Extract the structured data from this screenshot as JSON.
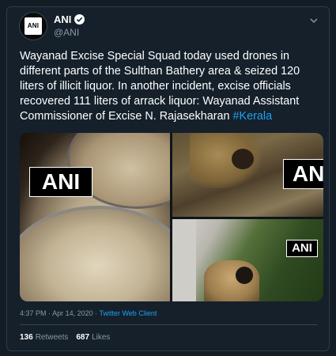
{
  "tweet": {
    "avatar_text": "ANI",
    "display_name": "ANI",
    "handle": "@ANI",
    "text": "Wayanad Excise Special Squad today used drones in different parts of the Sulthan Bathery area & seized 120 liters of illicit liquor. In another incident, excise officials recovered 111 liters of arrack liquor: Wayanad Assistant Commissioner of Excise N. Rajasekharan ",
    "hashtag": "#Kerala",
    "time": "4:37 PM",
    "date": "Apr 14, 2020",
    "separator": "·",
    "client": "Twitter Web Client",
    "retweets_count": "136",
    "retweets_label": "Retweets",
    "likes_count": "687",
    "likes_label": "Likes"
  },
  "media": {
    "watermark": "ANI"
  },
  "colors": {
    "background": "#15202b",
    "accent": "#1da1f2",
    "secondary_text": "#8899a6"
  }
}
